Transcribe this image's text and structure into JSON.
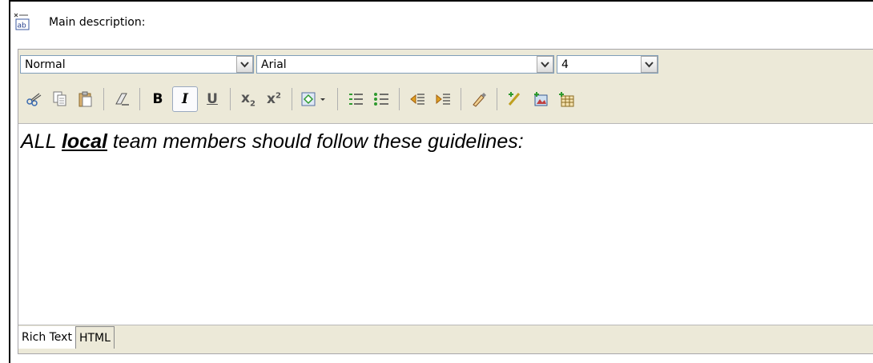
{
  "header": {
    "label": "Main description:"
  },
  "dropdowns": {
    "style": "Normal",
    "font": "Arial",
    "size": "4"
  },
  "toolbar": {
    "buttons": [
      "cut-icon",
      "copy-icon",
      "paste-icon",
      "clear-format-icon",
      "bold-icon",
      "italic-icon",
      "underline-icon",
      "subscript-icon",
      "superscript-icon",
      "insert-link-icon",
      "numbered-list-icon",
      "bulleted-list-icon",
      "outdent-icon",
      "indent-icon",
      "highlight-icon",
      "spell-check-icon",
      "insert-image-icon",
      "insert-table-icon"
    ],
    "bold": "B",
    "italic": "I",
    "underline": "U",
    "subscript": "x",
    "subscript_mark": "2",
    "superscript": "x",
    "superscript_mark": "2"
  },
  "content": {
    "pre": "ALL ",
    "emph": "local",
    "post": " team members should follow these guidelines:"
  },
  "tabs": [
    {
      "label": "Rich Text"
    },
    {
      "label": "HTML"
    }
  ],
  "colors": {
    "accent_green": "#2e9a2e",
    "toolbar_bg": "#ece9d8",
    "combo_border": "#7f9db9"
  }
}
